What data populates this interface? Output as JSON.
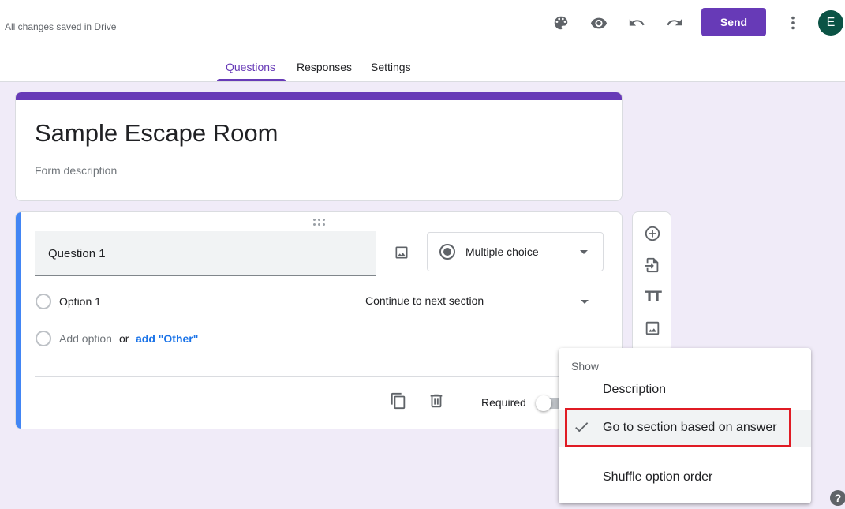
{
  "header": {
    "save_status": "All changes saved in Drive",
    "send_label": "Send",
    "avatar_letter": "E",
    "icons": [
      "palette-icon",
      "preview-eye-icon",
      "undo-icon",
      "redo-icon",
      "more-vert-icon"
    ]
  },
  "tabs": [
    {
      "label": "Questions",
      "active": true
    },
    {
      "label": "Responses",
      "active": false
    },
    {
      "label": "Settings",
      "active": false
    }
  ],
  "form": {
    "title": "Sample Escape Room",
    "description_placeholder": "Form description"
  },
  "question": {
    "title": "Question 1",
    "type": "Multiple choice",
    "options": [
      {
        "label": "Option 1",
        "section": "Continue to next section"
      }
    ],
    "add_option": "Add option",
    "or": "or",
    "add_other": "add \"Other\"",
    "required_label": "Required",
    "required": false
  },
  "menu": {
    "header": "Show",
    "items": [
      {
        "label": "Description",
        "checked": false
      },
      {
        "label": "Go to section based on answer",
        "checked": true
      },
      {
        "label": "Shuffle option order",
        "checked": false
      }
    ]
  },
  "colors": {
    "accent": "#673ab7",
    "active_question_bar": "#4285f4",
    "link": "#1a73e8",
    "highlight": "#e01b24",
    "background": "#f0ebf8"
  },
  "help_label": "?"
}
